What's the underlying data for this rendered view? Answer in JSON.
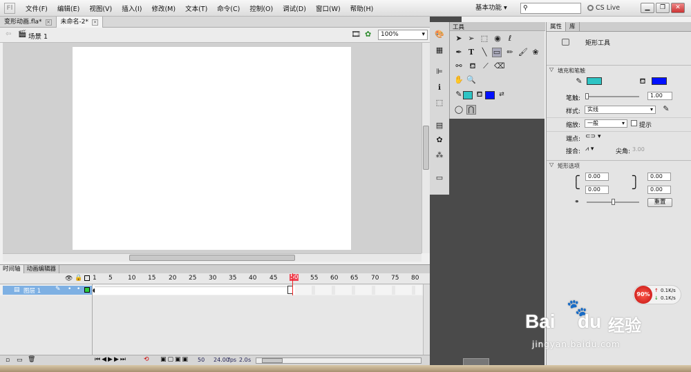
{
  "menubar": {
    "logo": "Fl",
    "items": [
      "文件(F)",
      "编辑(E)",
      "视图(V)",
      "插入(I)",
      "修改(M)",
      "文本(T)",
      "命令(C)",
      "控制(O)",
      "调试(D)",
      "窗口(W)",
      "帮助(H)"
    ],
    "workspace_label": "基本功能",
    "search_placeholder": "",
    "cs_live_label": "CS Live"
  },
  "document_tabs": [
    {
      "label": "变形动画.fla*",
      "active": false
    },
    {
      "label": "未命名-2*",
      "active": true
    }
  ],
  "edit_bar": {
    "scene_label": "场景 1",
    "zoom_value": "100%"
  },
  "timeline": {
    "tabs": [
      "时间轴",
      "动画编辑器"
    ],
    "frame_numbers": [
      "1",
      "5",
      "10",
      "15",
      "20",
      "25",
      "30",
      "35",
      "40",
      "45",
      "50",
      "55",
      "60",
      "65",
      "70",
      "75",
      "80"
    ],
    "layer_name": "图层 1",
    "current_frame": "50",
    "fps": "24.00",
    "fps_unit": "fps",
    "elapsed": "2.0",
    "elapsed_unit": "s"
  },
  "tools_panel": {
    "title": "工具",
    "stroke_color": "#2ec4c4",
    "fill_color": "#0010ff"
  },
  "properties": {
    "tabs": [
      "属性",
      "库"
    ],
    "tool_name": "矩形工具",
    "fill_stroke_section": "填充和笔触",
    "stroke_color": "#2ec4c4",
    "fill_color": "#0010ff",
    "stroke_label": "笔触:",
    "stroke_value": "1.00",
    "style_label": "样式:",
    "style_value": "实线",
    "scale_label": "缩放:",
    "scale_value": "一般",
    "hint_label": "提示",
    "cap_label": "端点:",
    "join_label": "接合:",
    "miter_label": "尖角:",
    "miter_value": "3.00",
    "rect_section": "矩形选项",
    "corner_tl": "0.00",
    "corner_tr": "0.00",
    "corner_bl": "0.00",
    "corner_br": "0.00",
    "reset_label": "重置"
  },
  "network_badge": {
    "percent": "90%",
    "up": "0.1K/s",
    "down": "0.1K/s"
  },
  "watermark": {
    "brand": "Bai",
    "brand2": "du",
    "brand_cn": "经验",
    "url": "jingyan.baidu.com"
  }
}
